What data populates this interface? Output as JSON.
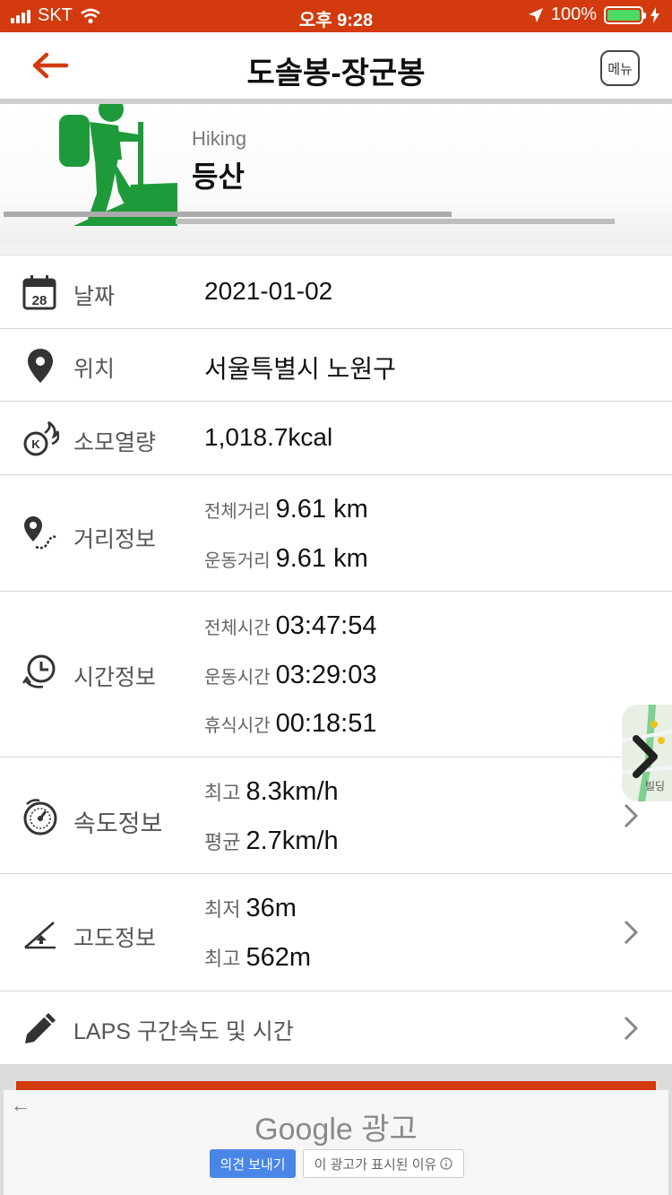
{
  "status_bar": {
    "carrier": "SKT",
    "time": "오후 9:28",
    "battery": "100%"
  },
  "header": {
    "title": "도솔봉-장군봉",
    "menu_label": "메뉴"
  },
  "activity": {
    "sub_title": "Hiking",
    "name": "등산",
    "icon_color": "#1f9a3a"
  },
  "rows": {
    "date": {
      "label": "날짜",
      "value": "2021-01-02",
      "icon_text": "28"
    },
    "location": {
      "label": "위치",
      "value": "서울특별시 노원구"
    },
    "calories": {
      "label": "소모열량",
      "value": "1,018.7kcal"
    },
    "distance": {
      "label": "거리정보",
      "items": [
        {
          "key": "전체거리",
          "value": "9.61 km"
        },
        {
          "key": "운동거리",
          "value": "9.61 km"
        }
      ]
    },
    "time": {
      "label": "시간정보",
      "items": [
        {
          "key": "전체시간",
          "value": "03:47:54"
        },
        {
          "key": "운동시간",
          "value": "03:29:03"
        },
        {
          "key": "휴식시간",
          "value": "00:18:51"
        }
      ]
    },
    "speed": {
      "label": "속도정보",
      "items": [
        {
          "key": "최고",
          "value": "8.3km/h"
        },
        {
          "key": "평균",
          "value": "2.7km/h"
        }
      ]
    },
    "altitude": {
      "label": "고도정보",
      "items": [
        {
          "key": "최저",
          "value": "36m"
        },
        {
          "key": "최고",
          "value": "562m"
        }
      ]
    },
    "laps": {
      "label": "LAPS 구간속도 및 시간"
    }
  },
  "map_thumb": {
    "label": "빌딩"
  },
  "ad": {
    "title": "Google 광고",
    "feedback_button": "의견 보내기",
    "why_button": "이 광고가 표시된 이유"
  },
  "colors": {
    "accent": "#d33a0e",
    "green": "#1f9a3a"
  }
}
